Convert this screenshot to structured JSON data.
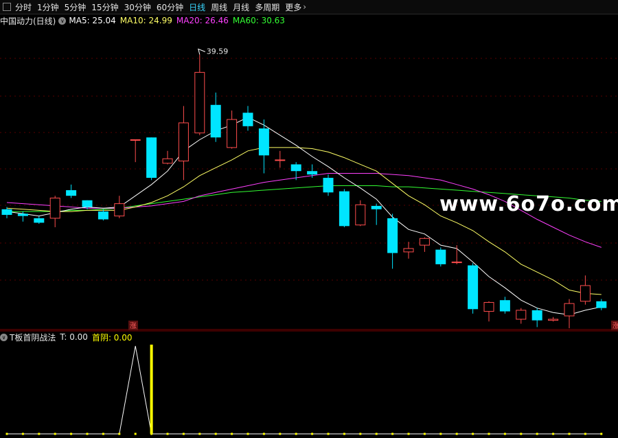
{
  "toolbar": {
    "periods": [
      "分时",
      "1分钟",
      "5分钟",
      "15分钟",
      "30分钟",
      "60分钟",
      "日线",
      "周线",
      "月线",
      "多周期",
      "更多"
    ],
    "active": "日线"
  },
  "legend": {
    "stock": "中国动力(日线)",
    "ma5": "MA5: 25.04",
    "ma10": "MA10: 24.99",
    "ma20": "MA20: 26.46",
    "ma60": "MA60: 30.63"
  },
  "colors": {
    "up": "#ff4d4d",
    "down": "#00e5ff",
    "ma5": "#ffffff",
    "ma10": "#ffff66",
    "ma20": "#ff40ff",
    "ma60": "#33ff33",
    "highlight": "#ffff00"
  },
  "max_price_label": "39.59",
  "zhang_label": "涨",
  "sub_legend": {
    "name": "T板首阴战法",
    "t_value": "T: 0.00",
    "shouyin_value": "首阴: 0.00"
  },
  "watermark": "www.6o7o.com",
  "chart_data": {
    "type": "candlestick",
    "y_range": [
      16,
      42
    ],
    "candles": [
      {
        "o": 25.8,
        "c": 25.3,
        "h": 26.0,
        "l": 25.0
      },
      {
        "o": 25.4,
        "c": 25.2,
        "h": 25.6,
        "l": 24.7
      },
      {
        "o": 25.0,
        "c": 24.6,
        "h": 25.2,
        "l": 24.5
      },
      {
        "o": 25.0,
        "c": 26.8,
        "h": 27.0,
        "l": 24.2
      },
      {
        "o": 27.5,
        "c": 27.0,
        "h": 28.0,
        "l": 26.8
      },
      {
        "o": 26.6,
        "c": 26.0,
        "h": 26.6,
        "l": 25.8
      },
      {
        "o": 25.6,
        "c": 24.9,
        "h": 25.8,
        "l": 24.8
      },
      {
        "o": 25.2,
        "c": 26.3,
        "h": 27.0,
        "l": 25.0
      },
      {
        "o": 32.0,
        "c": 32.0,
        "h": 32.0,
        "l": 30.0
      },
      {
        "o": 32.2,
        "c": 28.6,
        "h": 32.2,
        "l": 28.4
      },
      {
        "o": 29.9,
        "c": 30.3,
        "h": 31.0,
        "l": 29.8
      },
      {
        "o": 30.1,
        "c": 33.5,
        "h": 35.0,
        "l": 28.4
      },
      {
        "o": 32.6,
        "c": 38.0,
        "h": 39.59,
        "l": 32.4
      },
      {
        "o": 35.1,
        "c": 32.2,
        "h": 36.2,
        "l": 31.8
      },
      {
        "o": 31.3,
        "c": 33.8,
        "h": 34.6,
        "l": 31.2
      },
      {
        "o": 34.4,
        "c": 33.2,
        "h": 35.0,
        "l": 32.8
      },
      {
        "o": 33.0,
        "c": 30.6,
        "h": 33.8,
        "l": 29.0
      },
      {
        "o": 30.2,
        "c": 30.2,
        "h": 31.0,
        "l": 29.5
      },
      {
        "o": 29.8,
        "c": 29.2,
        "h": 30.0,
        "l": 28.4
      },
      {
        "o": 29.2,
        "c": 28.9,
        "h": 29.8,
        "l": 28.6
      },
      {
        "o": 28.6,
        "c": 27.3,
        "h": 28.9,
        "l": 27.0
      },
      {
        "o": 27.4,
        "c": 24.3,
        "h": 27.6,
        "l": 24.2
      },
      {
        "o": 24.4,
        "c": 26.2,
        "h": 26.6,
        "l": 24.3
      },
      {
        "o": 26.1,
        "c": 25.8,
        "h": 26.3,
        "l": 24.4
      },
      {
        "o": 25.0,
        "c": 21.9,
        "h": 25.4,
        "l": 20.5
      },
      {
        "o": 22.0,
        "c": 22.3,
        "h": 22.9,
        "l": 21.4
      },
      {
        "o": 22.6,
        "c": 23.2,
        "h": 23.3,
        "l": 22.0
      },
      {
        "o": 22.2,
        "c": 20.9,
        "h": 22.4,
        "l": 20.7
      },
      {
        "o": 21.1,
        "c": 21.1,
        "h": 22.6,
        "l": 20.9
      },
      {
        "o": 20.8,
        "c": 16.9,
        "h": 21.0,
        "l": 16.5
      },
      {
        "o": 16.7,
        "c": 17.5,
        "h": 17.6,
        "l": 15.8
      },
      {
        "o": 17.7,
        "c": 16.7,
        "h": 18.0,
        "l": 16.5
      },
      {
        "o": 16.0,
        "c": 16.8,
        "h": 17.0,
        "l": 15.6
      },
      {
        "o": 16.8,
        "c": 15.9,
        "h": 17.0,
        "l": 15.3
      },
      {
        "o": 15.9,
        "c": 16.0,
        "h": 16.2,
        "l": 15.8
      },
      {
        "o": 16.3,
        "c": 17.4,
        "h": 17.8,
        "l": 15.2
      },
      {
        "o": 17.6,
        "c": 19.0,
        "h": 19.9,
        "l": 17.3
      },
      {
        "o": 17.6,
        "c": 17.0,
        "h": 17.8,
        "l": 16.8
      }
    ],
    "ma5": [
      25.6,
      25.4,
      25.2,
      25.5,
      25.8,
      26.0,
      25.9,
      26.0,
      27.0,
      28.0,
      29.2,
      31.0,
      32.0,
      32.8,
      33.3,
      34.0,
      33.3,
      32.4,
      31.5,
      30.5,
      29.6,
      28.6,
      27.7,
      26.7,
      25.1,
      24.0,
      23.6,
      22.6,
      22.3,
      21.1,
      19.8,
      18.8,
      17.7,
      17.0,
      16.6,
      16.4,
      16.8,
      17.1
    ],
    "ma10": [
      25.9,
      25.8,
      25.7,
      25.6,
      25.6,
      25.7,
      25.7,
      25.7,
      26.0,
      26.4,
      27.0,
      27.8,
      28.8,
      29.5,
      30.2,
      31.0,
      31.3,
      31.3,
      31.3,
      31.2,
      30.9,
      30.4,
      29.8,
      29.2,
      28.1,
      27.0,
      26.2,
      25.2,
      24.6,
      23.9,
      22.9,
      22.0,
      20.9,
      20.2,
      19.5,
      18.6,
      18.3,
      18.2
    ],
    "ma20": [
      26.4,
      26.3,
      26.2,
      26.1,
      26.0,
      25.9,
      25.9,
      25.9,
      26.0,
      26.1,
      26.3,
      26.5,
      27.0,
      27.3,
      27.6,
      27.9,
      28.2,
      28.4,
      28.6,
      28.8,
      29.0,
      29.0,
      29.0,
      29.0,
      28.9,
      28.8,
      28.6,
      28.4,
      28.0,
      27.6,
      27.1,
      26.5,
      25.7,
      24.9,
      24.2,
      23.5,
      22.9,
      22.4
    ],
    "ma60": [
      25.6,
      25.6,
      25.6,
      25.6,
      25.7,
      25.7,
      25.8,
      25.9,
      26.1,
      26.3,
      26.5,
      26.7,
      26.9,
      27.1,
      27.3,
      27.4,
      27.5,
      27.6,
      27.7,
      27.8,
      27.9,
      27.9,
      27.9,
      27.9,
      27.8,
      27.8,
      27.7,
      27.6,
      27.5,
      27.4,
      27.3,
      27.2,
      27.1,
      27.0,
      26.9,
      26.8,
      26.6,
      26.5
    ],
    "indicator": {
      "t_spike_index": 8,
      "shouyin_index": 9,
      "baseline": 0
    }
  }
}
